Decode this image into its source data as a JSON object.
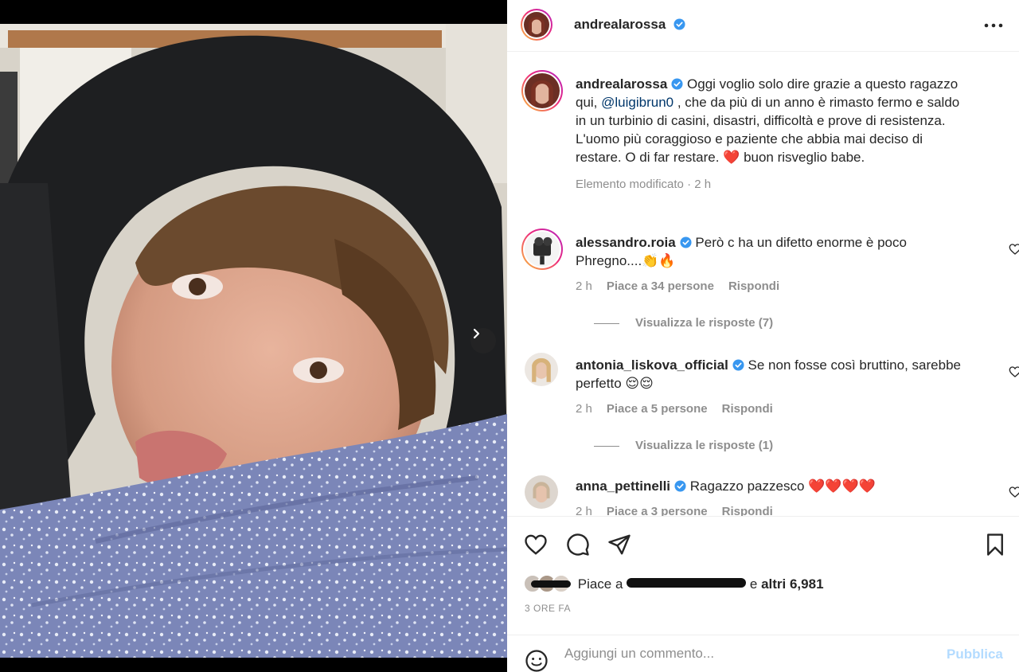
{
  "post": {
    "author": "andrealarossa",
    "caption_author": "andrealarossa",
    "caption_part1": "Oggi voglio solo dire grazie a questo ragazzo qui, ",
    "caption_mention": "@luigibrun0",
    "caption_part2": " , che da più di un anno è rimasto fermo e saldo in un turbinio di casini, disastri, difficoltà e prove di resistenza. L'uomo più coraggioso e paziente che abbia mai deciso di restare. O di far restare. ❤️ buon risveglio babe.",
    "caption_meta": "Elemento modificato · 2 h"
  },
  "comments": [
    {
      "user": "alessandro.roia",
      "text": "Però c ha un difetto enorme è poco Phregno....👏🔥",
      "time": "2 h",
      "likes": "Piace a 34 persone",
      "reply": "Rispondi",
      "view_replies": "Visualizza le risposte (7)"
    },
    {
      "user": "antonia_liskova_official",
      "text": "Se non fosse così bruttino, sarebbe perfetto 😌😌",
      "time": "2 h",
      "likes": "Piace a 5 persone",
      "reply": "Rispondi",
      "view_replies": "Visualizza le risposte (1)"
    },
    {
      "user": "anna_pettinelli",
      "text": "Ragazzo pazzesco ❤️❤️❤️❤️",
      "time": "2 h",
      "likes": "Piace a 3 persone",
      "reply": "Rispondi"
    }
  ],
  "likes": {
    "prefix": "Piace a ",
    "middle": " e ",
    "others": "altri 6,981"
  },
  "timestamp": "3 ORE FA",
  "add_comment": {
    "placeholder": "Aggiungi un commento...",
    "publish": "Pubblica"
  },
  "colors": {
    "accent": "#0095f6",
    "verified": "#3897f0",
    "mention": "#00376b",
    "muted": "#8e8e8e",
    "publish_disabled": "#b3dbff"
  },
  "icons": [
    "chevron-right-icon",
    "more-icon",
    "verified-icon",
    "heart-icon",
    "comment-icon",
    "share-icon",
    "bookmark-icon",
    "emoji-icon"
  ]
}
